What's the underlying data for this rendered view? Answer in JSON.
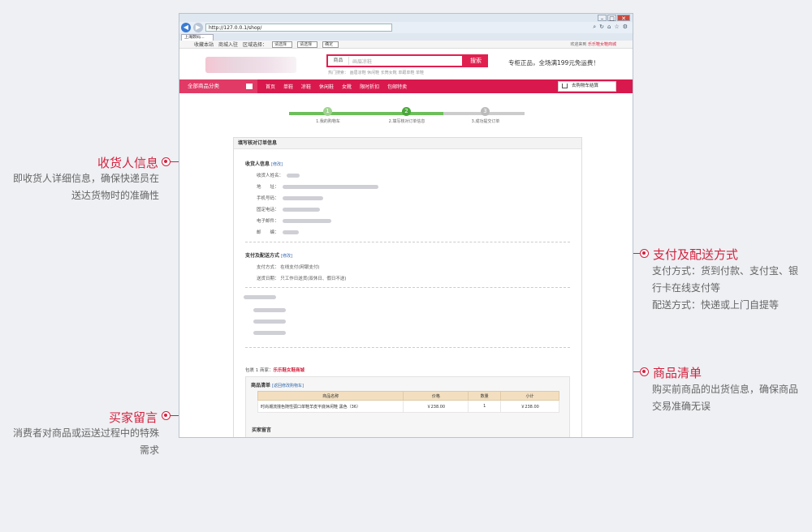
{
  "colors": {
    "accent": "#d4223f",
    "nav": "#d9194d",
    "step_done": "#4aa83a"
  },
  "annotations": {
    "receiver": {
      "title": "收货人信息",
      "desc": [
        "即收货人详细信息，确保快递员在",
        "送达货物时的准确性"
      ]
    },
    "payment": {
      "title": "支付及配送方式",
      "desc": [
        "支付方式：货到付款、支付宝、银",
        "行卡在线支付等",
        "配送方式：快递或上门自提等"
      ]
    },
    "goods": {
      "title": "商品清单",
      "desc": [
        "购买前商品的出货信息，确保商品",
        "交易准确无误"
      ]
    },
    "message": {
      "title": "买家留言",
      "desc": [
        "消费者对商品或运送过程中的特殊",
        "需求"
      ]
    }
  },
  "browser": {
    "url": "http://127.0.0.1/shop/",
    "tab_label": "上海数码...",
    "fav_items": [
      "收藏本站",
      "商城入驻",
      "区域选择："
    ],
    "selects": [
      "请选择",
      "请选择"
    ],
    "confirm": "确定",
    "welcome": "欢迎来到",
    "shop_name": "乐乐鞋女鞋商城"
  },
  "header": {
    "search_category": "商品",
    "search_placeholder": "画眉凉鞋",
    "search_button": "搜索",
    "hot_words": "热门搜索： 画眉凉鞋  休闲鞋  长筒女靴  单跟单鞋  单鞋",
    "slogan": "专柜正品，全场满199元免运费！"
  },
  "nav": {
    "all_categories": "全部商品分类",
    "items": [
      "首页",
      "单鞋",
      "凉鞋",
      "休闲鞋",
      "女靴",
      "限时折扣",
      "包邮特卖"
    ],
    "cart": "去购物车结算"
  },
  "steps": [
    {
      "num": "1",
      "label": "1.我的购物车"
    },
    {
      "num": "2",
      "label": "2.填写核对订单信息"
    },
    {
      "num": "3",
      "label": "3.成功提交订单"
    }
  ],
  "order": {
    "box_title": "填写核对订单信息",
    "receiver_title": "收货人信息",
    "edit": "[修改]",
    "receiver_fields": [
      "收货人姓名：",
      "地　　址：",
      "手机号码：",
      "固定电话：",
      "电子邮件：",
      "邮　　编："
    ],
    "payment_title": "支付及配送方式",
    "payment_fields": [
      {
        "label": "支付方式：",
        "value": "在线支付(网银支付)"
      },
      {
        "label": "送货日期：",
        "value": "只工作日送货(双休日、假日不送)"
      }
    ],
    "package_prefix": "包裹 1 商家：",
    "package_shop": "乐乐鞋女鞋商城",
    "goods_title": "商品清单",
    "goods_back": "[返回修改购物车]",
    "table_headers": [
      "商品名称",
      "价格",
      "数量",
      "小计"
    ],
    "table_rows": [
      {
        "name": "时尚潮流撞色随性弧口单鞋羊皮平底休闲鞋 黑色（36）",
        "price": "￥238.00",
        "qty": "1",
        "subtotal": "￥238.00"
      }
    ],
    "message_title": "买家留言"
  }
}
